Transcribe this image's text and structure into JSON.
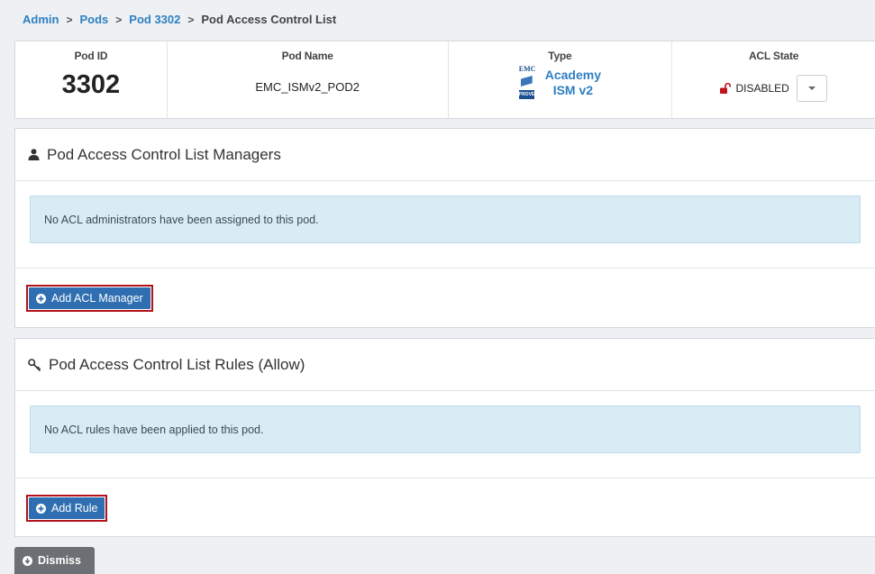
{
  "breadcrumb": {
    "items": [
      "Admin",
      "Pods",
      "Pod 3302"
    ],
    "separator": ">",
    "current": "Pod Access Control List"
  },
  "pod_info": {
    "headers": {
      "pod_id": "Pod ID",
      "pod_name": "Pod Name",
      "type": "Type",
      "acl_state": "ACL State"
    },
    "pod_id": "3302",
    "pod_name": "EMC_ISMv2_POD2",
    "type_line1": "Academy",
    "type_line2": "ISM v2",
    "type_logo_text": "EMC",
    "type_logo_badge": "PROVEN",
    "acl_state": "DISABLED",
    "acl_state_icon": "unlock-icon"
  },
  "managers_panel": {
    "title": "Pod Access Control List Managers",
    "icon": "user-icon",
    "alert": "No ACL administrators have been assigned to this pod.",
    "button_label": "Add ACL Manager"
  },
  "rules_panel": {
    "title": "Pod Access Control List Rules (Allow)",
    "icon": "key-icon",
    "alert": "No ACL rules have been applied to this pod.",
    "button_label": "Add Rule"
  },
  "dismiss_label": "Dismiss",
  "colors": {
    "link": "#2e7fc2",
    "primary_button": "#2f6fb1",
    "highlight_outline": "#b3121b",
    "alert_bg": "#d9ecf5",
    "lock_red": "#c0141b",
    "dismiss_bg": "#6c6f73"
  }
}
